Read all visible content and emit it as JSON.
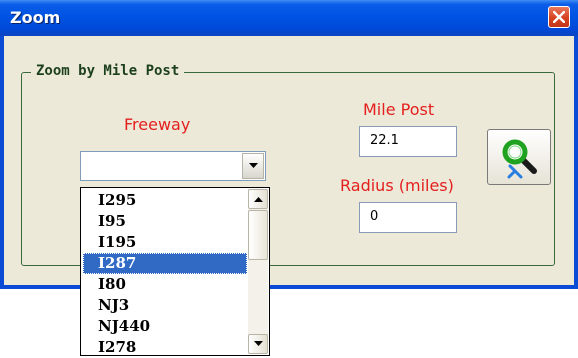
{
  "window": {
    "title": "Zoom",
    "close_icon": "close-x-icon"
  },
  "group": {
    "legend": "Zoom by Mile Post"
  },
  "freeway": {
    "label": "Freeway",
    "value": "",
    "options": [
      "I295",
      "I95",
      "I195",
      "I287",
      "I80",
      "NJ3",
      "NJ440",
      "I278"
    ],
    "selected": "I287"
  },
  "mile_post": {
    "label": "Mile Post",
    "value": "22.1"
  },
  "radius": {
    "label": "Radius (miles)",
    "value": "0"
  },
  "zoom_button": {
    "icon": "magnifier-zoom-icon"
  },
  "colors": {
    "titlebar": "#0054e3",
    "label_red": "#e4201f",
    "legend_green": "#1c3f1c",
    "selection": "#316ac5",
    "dialog_bg": "#ece9d8"
  }
}
